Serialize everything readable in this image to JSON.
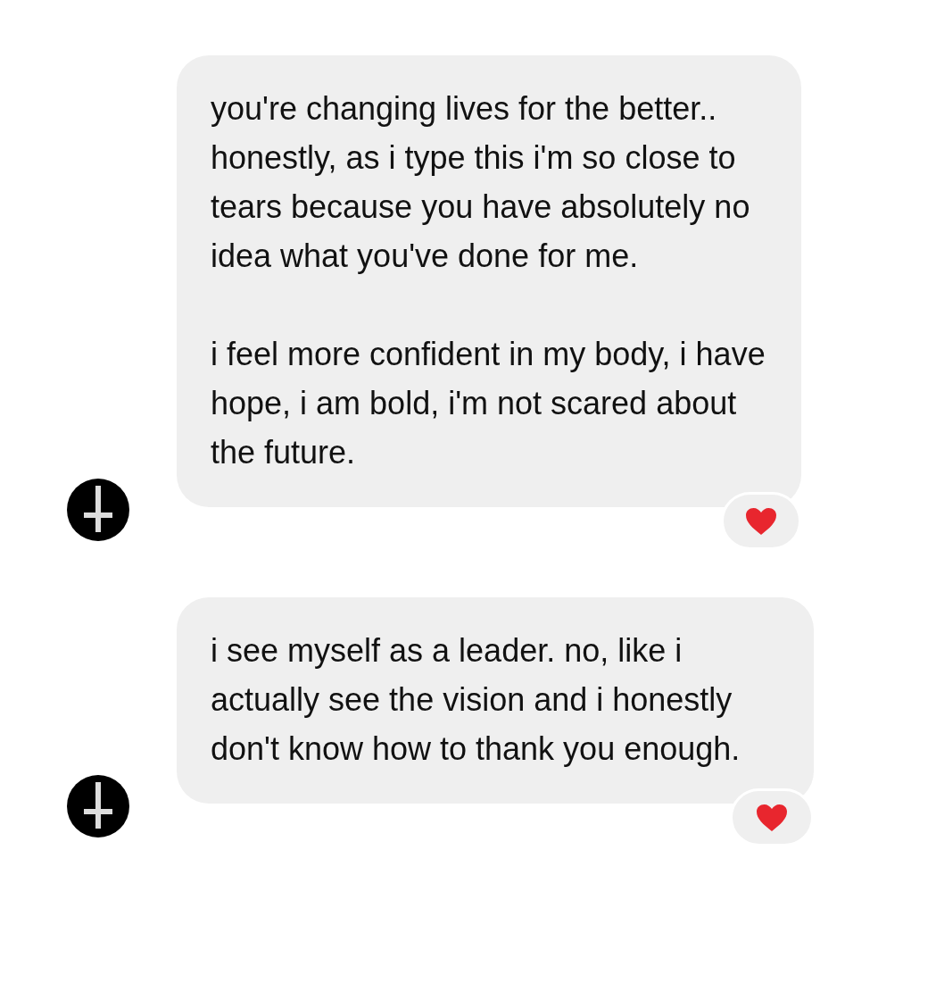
{
  "messages": [
    {
      "paragraphs": [
        "you're changing lives for the better.. honestly, as i type this i'm so close to tears because you have absolutely no idea what you've done for me.",
        "i feel more confident in my body, i have hope, i am bold, i'm not scared about the future."
      ],
      "reacted": true
    },
    {
      "paragraphs": [
        "i see myself as a leader. no, like i actually see the vision and i honestly don't know how to thank you enough."
      ],
      "reacted": true
    }
  ]
}
